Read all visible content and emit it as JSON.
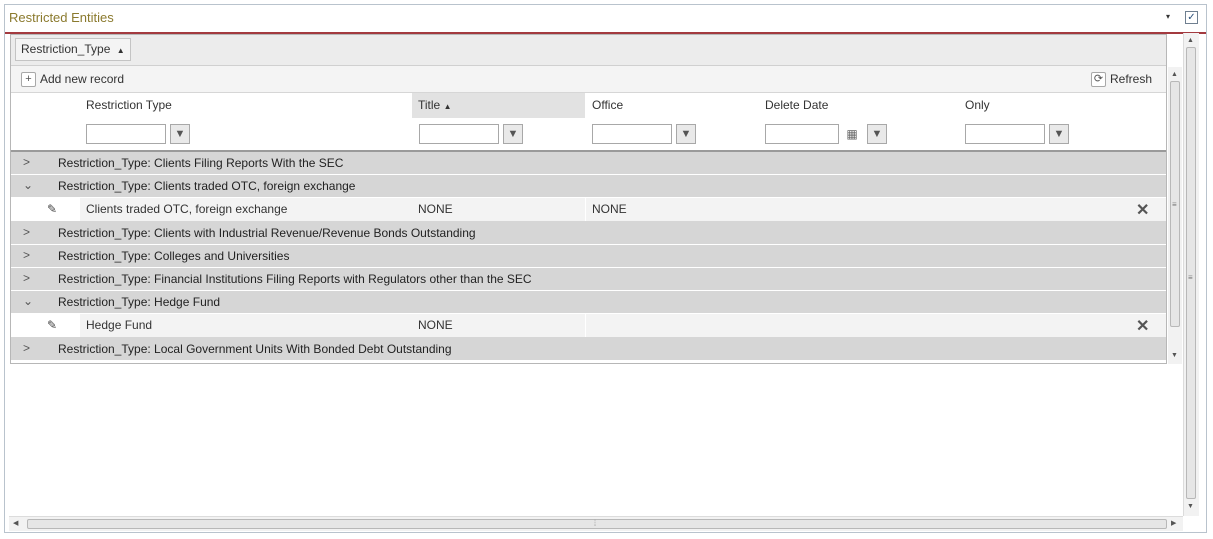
{
  "panel": {
    "title": "Restricted Entities",
    "collapse_glyph": "▾",
    "check_glyph": "✓"
  },
  "group_chip": {
    "label": "Restriction_Type",
    "sort_glyph": "▲"
  },
  "toolbar": {
    "add_label": "Add new record",
    "add_icon": "plus-icon",
    "refresh_label": "Refresh",
    "refresh_icon": "refresh-icon"
  },
  "columns": [
    {
      "label": "Restriction Type"
    },
    {
      "label": "Title",
      "sort_glyph": "▲"
    },
    {
      "label": "Office"
    },
    {
      "label": "Delete Date"
    },
    {
      "label": "Only"
    }
  ],
  "filter_glyph": "▼",
  "calendar_glyph": "▦",
  "rows": [
    {
      "kind": "group",
      "glyph": ">",
      "text": "Restriction_Type: Clients Filing Reports With the SEC"
    },
    {
      "kind": "group",
      "glyph": "⌄",
      "text": "Restriction_Type: Clients traded OTC, foreign exchange"
    },
    {
      "kind": "data",
      "restriction_type": "Clients traded OTC, foreign exchange",
      "title": "NONE",
      "office": "NONE"
    },
    {
      "kind": "group",
      "glyph": ">",
      "text": "Restriction_Type: Clients with Industrial Revenue/Revenue Bonds Outstanding"
    },
    {
      "kind": "group",
      "glyph": ">",
      "text": "Restriction_Type: Colleges and Universities"
    },
    {
      "kind": "group",
      "glyph": ">",
      "text": "Restriction_Type: Financial Institutions Filing Reports with Regulators other than the SEC"
    },
    {
      "kind": "group",
      "glyph": "⌄",
      "text": "Restriction_Type: Hedge Fund"
    },
    {
      "kind": "data",
      "restriction_type": "Hedge Fund",
      "title": "NONE",
      "office": ""
    },
    {
      "kind": "group",
      "glyph": ">",
      "text": "Restriction_Type: Local Government Units With Bonded Debt Outstanding"
    }
  ],
  "icons": {
    "edit": "✎",
    "delete": "✕",
    "plus": "+",
    "refresh": "⟳"
  },
  "colors": {
    "title": "#8b7a2e",
    "header_rule": "#a33a3f",
    "group_row": "#d6d6d6"
  }
}
